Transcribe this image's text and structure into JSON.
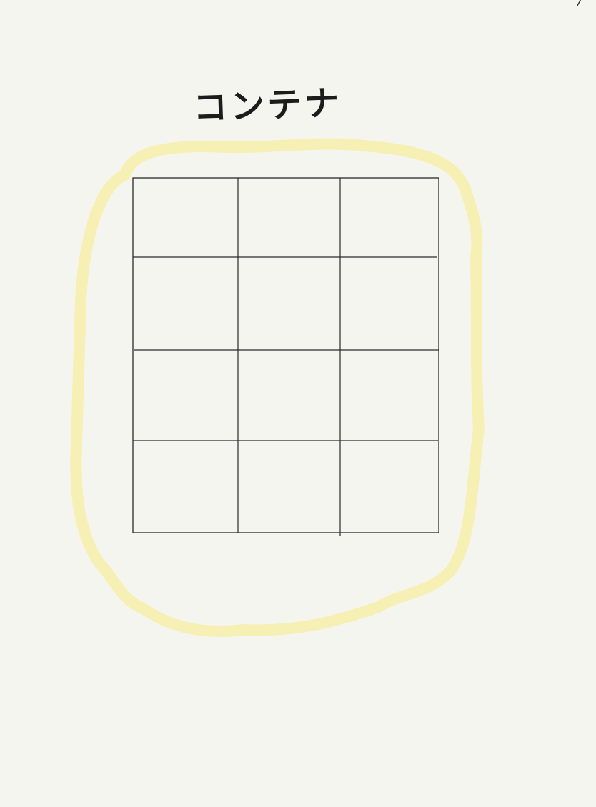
{
  "page": {
    "number": "/",
    "background_color": "#f5f5f0"
  },
  "diagram": {
    "title": "コンテナ",
    "container": {
      "highlight_color": "#f7f0b4",
      "grid": {
        "rows": 4,
        "columns": 3,
        "line_color": "#2a2a2a"
      }
    }
  }
}
